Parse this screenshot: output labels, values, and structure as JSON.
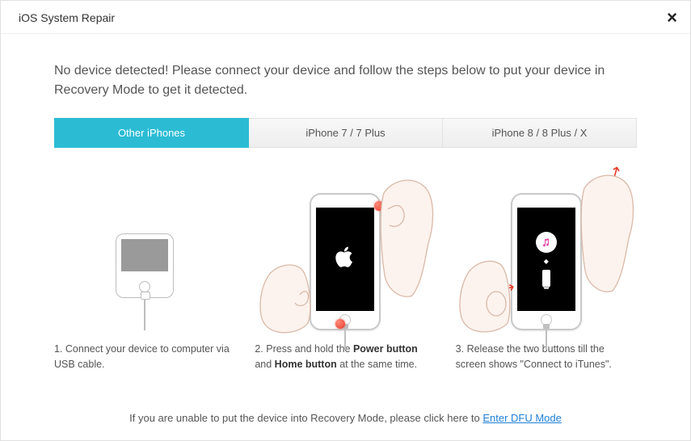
{
  "titlebar": {
    "title": "iOS System Repair",
    "close_label": "×"
  },
  "message": "No device detected! Please connect your device and follow the steps below to put your device in Recovery Mode to get it detected.",
  "tabs": [
    {
      "label": "Other iPhones",
      "active": true
    },
    {
      "label": "iPhone 7 / 7 Plus",
      "active": false
    },
    {
      "label": "iPhone 8 / 8 Plus / X",
      "active": false
    }
  ],
  "steps": {
    "s1": {
      "prefix": "1. ",
      "text": "Connect your device to computer via USB cable."
    },
    "s2": {
      "prefix": "2. ",
      "pre": "Press and hold the ",
      "b1": "Power button",
      "mid": " and ",
      "b2": "Home button",
      "post": " at the same time."
    },
    "s3": {
      "prefix": "3. ",
      "text": "Release the two buttons till the screen shows \"Connect to iTunes\"."
    }
  },
  "footer": {
    "text": "If you are unable to put the device into Recovery Mode, please click here to ",
    "link": "Enter DFU Mode"
  }
}
